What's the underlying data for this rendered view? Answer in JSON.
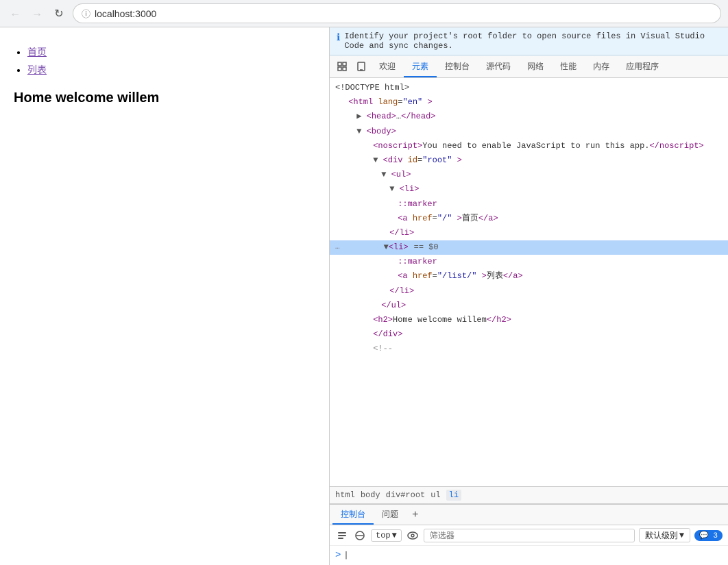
{
  "browser": {
    "url": "localhost:3000"
  },
  "page": {
    "nav_items": [
      {
        "label": "首页",
        "href": "/"
      },
      {
        "label": "列表",
        "href": "/list/"
      }
    ],
    "heading": "Home welcome willem"
  },
  "devtools": {
    "banner": {
      "icon": "ℹ",
      "text": "Identify your project's root folder to open source files in Visual Studio Code and sync changes."
    },
    "tabs": [
      {
        "label": "欢迎",
        "id": "welcome"
      },
      {
        "label": "元素",
        "id": "elements",
        "active": true
      },
      {
        "label": "控制台",
        "id": "console"
      },
      {
        "label": "源代码",
        "id": "sources"
      },
      {
        "label": "网络",
        "id": "network"
      },
      {
        "label": "性能",
        "id": "performance"
      },
      {
        "label": "内存",
        "id": "memory"
      },
      {
        "label": "应用程序",
        "id": "application"
      }
    ],
    "dom": [
      {
        "indent": 0,
        "content": "&lt;!DOCTYPE html&gt;"
      },
      {
        "indent": 1,
        "content": "&lt;html lang=\"en\"&gt;"
      },
      {
        "indent": 2,
        "content": "▶ &lt;head&gt;…&lt;/head&gt;"
      },
      {
        "indent": 2,
        "content": "▼ &lt;body&gt;"
      },
      {
        "indent": 3,
        "content": "&lt;noscript&gt;You need to enable JavaScript to run this app.&lt;/noscript&gt;"
      },
      {
        "indent": 3,
        "content": "▼ &lt;div id=\"root\"&gt;"
      },
      {
        "indent": 4,
        "content": "▼ &lt;ul&gt;"
      },
      {
        "indent": 5,
        "content": "▼ &lt;li&gt;"
      },
      {
        "indent": 6,
        "content": "::marker"
      },
      {
        "indent": 6,
        "content": "&lt;a href=\"/\"&gt;首页&lt;/a&gt;"
      },
      {
        "indent": 5,
        "content": "&lt;/li&gt;"
      }
    ],
    "dom_highlighted": "▼ &lt;li&gt; == $0",
    "dom2": [
      {
        "indent": 6,
        "content": "::marker"
      },
      {
        "indent": 6,
        "content": "&lt;a href=\"/list/\"&gt;列表&lt;/a&gt;"
      },
      {
        "indent": 5,
        "content": "&lt;/li&gt;"
      },
      {
        "indent": 4,
        "content": "&lt;/ul&gt;"
      },
      {
        "indent": 3,
        "content": "&lt;h2&gt;Home welcome willem&lt;/h2&gt;"
      },
      {
        "indent": 2,
        "content": "&lt;/div&gt;"
      },
      {
        "indent": 2,
        "content": "&lt;!--"
      }
    ],
    "breadcrumb": [
      {
        "label": "html",
        "active": false
      },
      {
        "label": "body",
        "active": false
      },
      {
        "label": "div#root",
        "active": false
      },
      {
        "label": "ul",
        "active": false
      },
      {
        "label": "li",
        "active": true
      }
    ],
    "console_tabs": [
      {
        "label": "控制台",
        "active": true
      },
      {
        "label": "问题",
        "active": false
      }
    ],
    "console_toolbar": {
      "top_label": "top",
      "filter_placeholder": "筛选器",
      "level_label": "默认级别",
      "badge_count": "3"
    }
  }
}
